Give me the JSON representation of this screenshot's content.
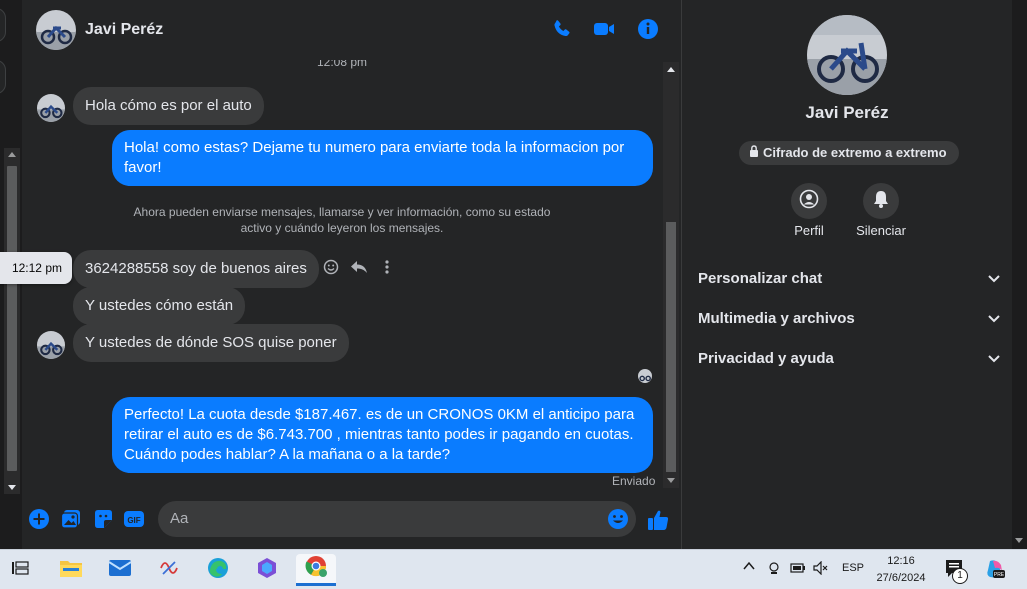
{
  "contact": {
    "name": "Javi Peréz"
  },
  "messages": {
    "time_separator": "12:08 pm",
    "incoming_1": "Hola cómo es por el auto",
    "outgoing_1": "Hola! como estas? Dejame tu numero para enviarte toda la informacion por favor!",
    "system_note": "Ahora pueden enviarse mensajes, llamarse y ver información, como su estado activo y cuándo leyeron los mensajes.",
    "hover_time": "12:12 pm",
    "incoming_2": "3624288558 soy de buenos aires",
    "incoming_3": "Y ustedes cómo están",
    "incoming_4": "Y ustedes de  dónde SOS quise poner",
    "outgoing_2": "Perfecto! La cuota desde $187.467. es de un CRONOS 0KM el anticipo para retirar el auto es de $6.743.700 , mientras tanto podes ir pagando en cuotas. Cuándo podes hablar? A la mañana o a la tarde?",
    "status": "Enviado"
  },
  "composer": {
    "placeholder": "Aa"
  },
  "panel": {
    "name": "Javi Peréz",
    "encryption": "Cifrado de extremo a extremo",
    "profile_label": "Perfil",
    "mute_label": "Silenciar",
    "sections": [
      "Personalizar chat",
      "Multimedia y archivos",
      "Privacidad y ayuda"
    ]
  },
  "taskbar": {
    "lang": "ESP",
    "time": "12:16",
    "date": "27/6/2024",
    "notif_count": "1"
  },
  "colors": {
    "accent": "#0a7cff",
    "bg": "#242526",
    "bubble_in": "#3a3b3c"
  }
}
